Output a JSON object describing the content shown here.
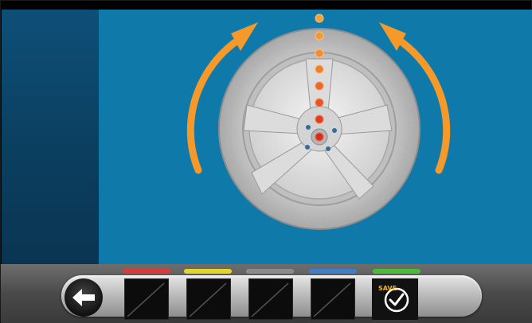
{
  "screen": {
    "title": ""
  },
  "icons": {
    "wheel": "wheel-icon",
    "rotate_left": "rotate-left-arrow-icon",
    "rotate_right": "rotate-right-arrow-icon",
    "back": "back-arrow-icon",
    "save": "save-check-icon"
  },
  "colors": {
    "background": "#0f7aa9",
    "sidebar": "#0b3f60",
    "arrow": "#f59a2a",
    "tab_red": "#d93b3b",
    "tab_yellow": "#e3d62b",
    "tab_gray": "#8c8c8c",
    "tab_blue": "#3f7fc9",
    "tab_green": "#4dbb3a"
  },
  "toolbar": {
    "save_label": "SAVE"
  }
}
